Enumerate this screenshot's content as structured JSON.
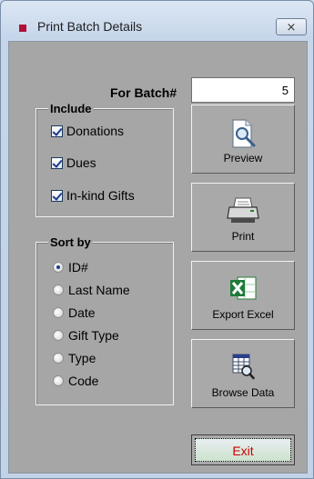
{
  "window": {
    "title": "Print Batch Details",
    "close_glyph": "⨯"
  },
  "batch": {
    "label": "For Batch#",
    "value": "5"
  },
  "include": {
    "legend": "Include",
    "items": [
      {
        "label": "Donations",
        "checked": true
      },
      {
        "label": "Dues",
        "checked": true
      },
      {
        "label": "In-kind Gifts",
        "checked": true
      }
    ]
  },
  "sort": {
    "legend": "Sort by",
    "options": [
      "ID#",
      "Last Name",
      "Date",
      "Gift Type",
      "Type",
      "Code"
    ],
    "selected": "ID#"
  },
  "buttons": {
    "preview": "Preview",
    "print": "Print",
    "export_excel": "Export Excel",
    "browse_data": "Browse Data",
    "exit": "Exit"
  },
  "icons": {
    "title": "app-icon",
    "preview": "magnifier-document-icon",
    "print": "printer-icon",
    "export_excel": "excel-icon",
    "browse_data": "browse-table-icon"
  },
  "colors": {
    "exit_text": "#cc0000",
    "title_icon": "#b0103a"
  }
}
